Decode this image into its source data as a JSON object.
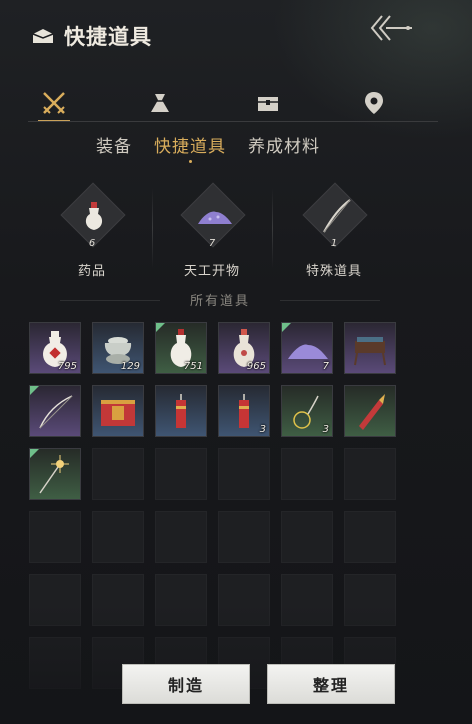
{
  "header": {
    "title": "快捷道具",
    "title_icon": "bag-icon",
    "back_icon": "back-arrow-icon"
  },
  "tabs": [
    {
      "icon": "crossed-swords-icon",
      "active": true
    },
    {
      "icon": "pouch-icon",
      "active": false
    },
    {
      "icon": "chest-icon",
      "active": false
    },
    {
      "icon": "location-pin-icon",
      "active": false
    }
  ],
  "subtabs": [
    {
      "label": "装备",
      "active": false
    },
    {
      "label": "快捷道具",
      "active": true
    },
    {
      "label": "养成材料",
      "active": false
    }
  ],
  "categories": [
    {
      "name": "药品",
      "count": "6",
      "icon": "medicine-vase-icon"
    },
    {
      "name": "天工开物",
      "count": "7",
      "icon": "powder-pile-icon"
    },
    {
      "name": "特殊道具",
      "count": "1",
      "icon": "bow-icon"
    }
  ],
  "section_title": "所有道具",
  "accent_color": "#d9ad5c",
  "items": [
    {
      "icon": "red-vase-icon",
      "qty": "795",
      "rarity": "purple",
      "new": false
    },
    {
      "icon": "jar-icon",
      "qty": "129",
      "rarity": "blue",
      "new": false
    },
    {
      "icon": "white-vase-icon",
      "qty": "751",
      "rarity": "green",
      "new": true
    },
    {
      "icon": "pink-vase-icon",
      "qty": "965",
      "rarity": "purple",
      "new": false
    },
    {
      "icon": "purple-powder-icon",
      "qty": "7",
      "rarity": "purple",
      "new": true
    },
    {
      "icon": "incense-burner-icon",
      "qty": "",
      "rarity": "purple",
      "new": false
    },
    {
      "icon": "bow-string-icon",
      "qty": "",
      "rarity": "purple",
      "new": true
    },
    {
      "icon": "gift-box-icon",
      "qty": "",
      "rarity": "blue",
      "new": false
    },
    {
      "icon": "firecracker-icon",
      "qty": "",
      "rarity": "blue",
      "new": false
    },
    {
      "icon": "firecracker-icon",
      "qty": "3",
      "rarity": "blue",
      "new": false
    },
    {
      "icon": "fuse-wire-icon",
      "qty": "3",
      "rarity": "green",
      "new": false
    },
    {
      "icon": "rocket-icon",
      "qty": "",
      "rarity": "green",
      "new": false
    },
    {
      "icon": "sparkler-icon",
      "qty": "",
      "rarity": "green",
      "new": true
    }
  ],
  "buttons": {
    "craft": "制造",
    "sort": "整理"
  }
}
